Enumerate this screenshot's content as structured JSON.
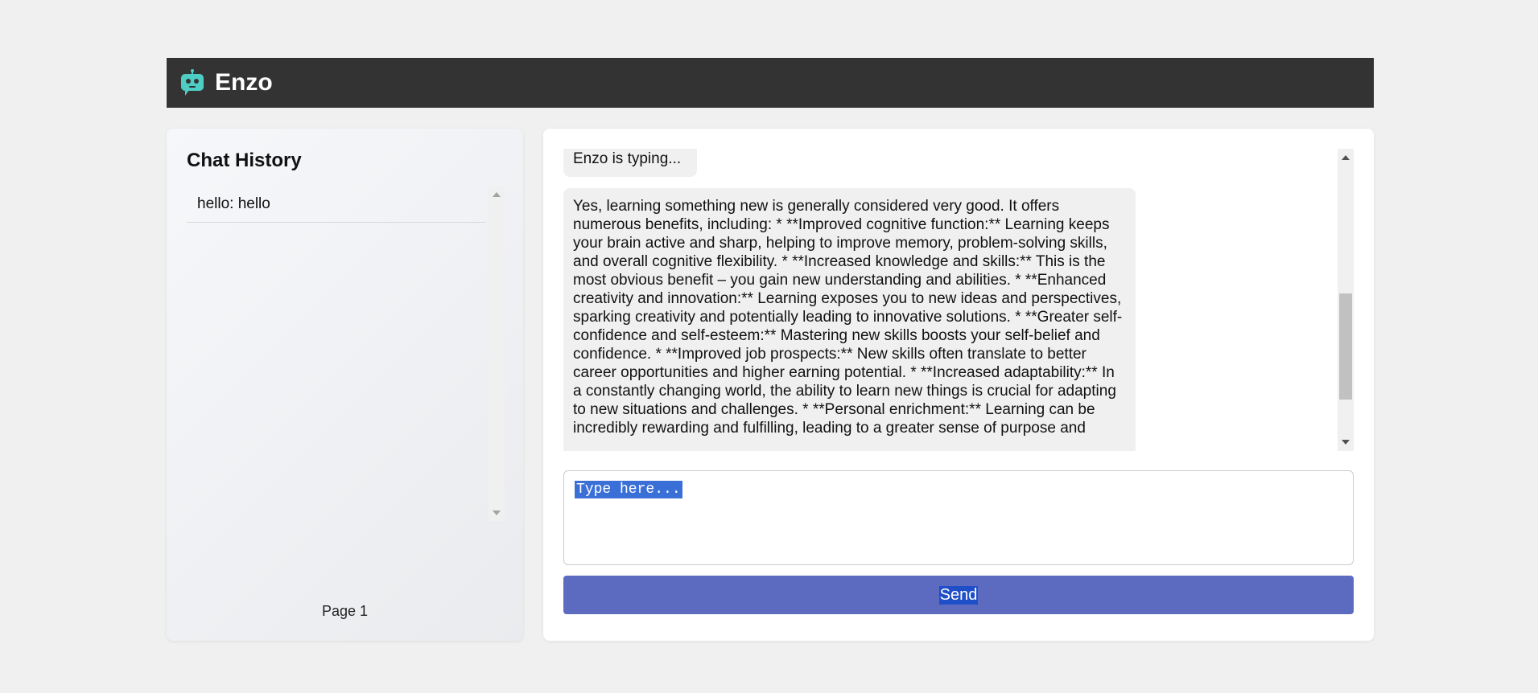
{
  "app": {
    "title": "Enzo"
  },
  "sidebar": {
    "title": "Chat History",
    "items": [
      {
        "label": "hello: hello"
      }
    ],
    "page_label": "Page 1"
  },
  "chat": {
    "typing_text": "Enzo is typing...",
    "reply_text": "Yes, learning something new is generally considered very good. It offers numerous benefits, including: * **Improved cognitive function:** Learning keeps your brain active and sharp, helping to improve memory, problem-solving skills, and overall cognitive flexibility. * **Increased knowledge and skills:** This is the most obvious benefit – you gain new understanding and abilities. * **Enhanced creativity and innovation:** Learning exposes you to new ideas and perspectives, sparking creativity and potentially leading to innovative solutions. * **Greater self-confidence and self-esteem:** Mastering new skills boosts your self-belief and confidence. * **Improved job prospects:** New skills often translate to better career opportunities and higher earning potential. * **Increased adaptability:** In a constantly changing world, the ability to learn new things is crucial for adapting to new situations and challenges. * **Personal enrichment:** Learning can be incredibly rewarding and fulfilling, leading to a greater sense of purpose and"
  },
  "input": {
    "placeholder": "Type here..."
  },
  "send": {
    "label": "Send"
  },
  "colors": {
    "header_bg": "#333333",
    "send_bg": "#5c6bc0",
    "logo": "#4ecdc4"
  },
  "icons": {
    "logo": "robot-icon"
  }
}
